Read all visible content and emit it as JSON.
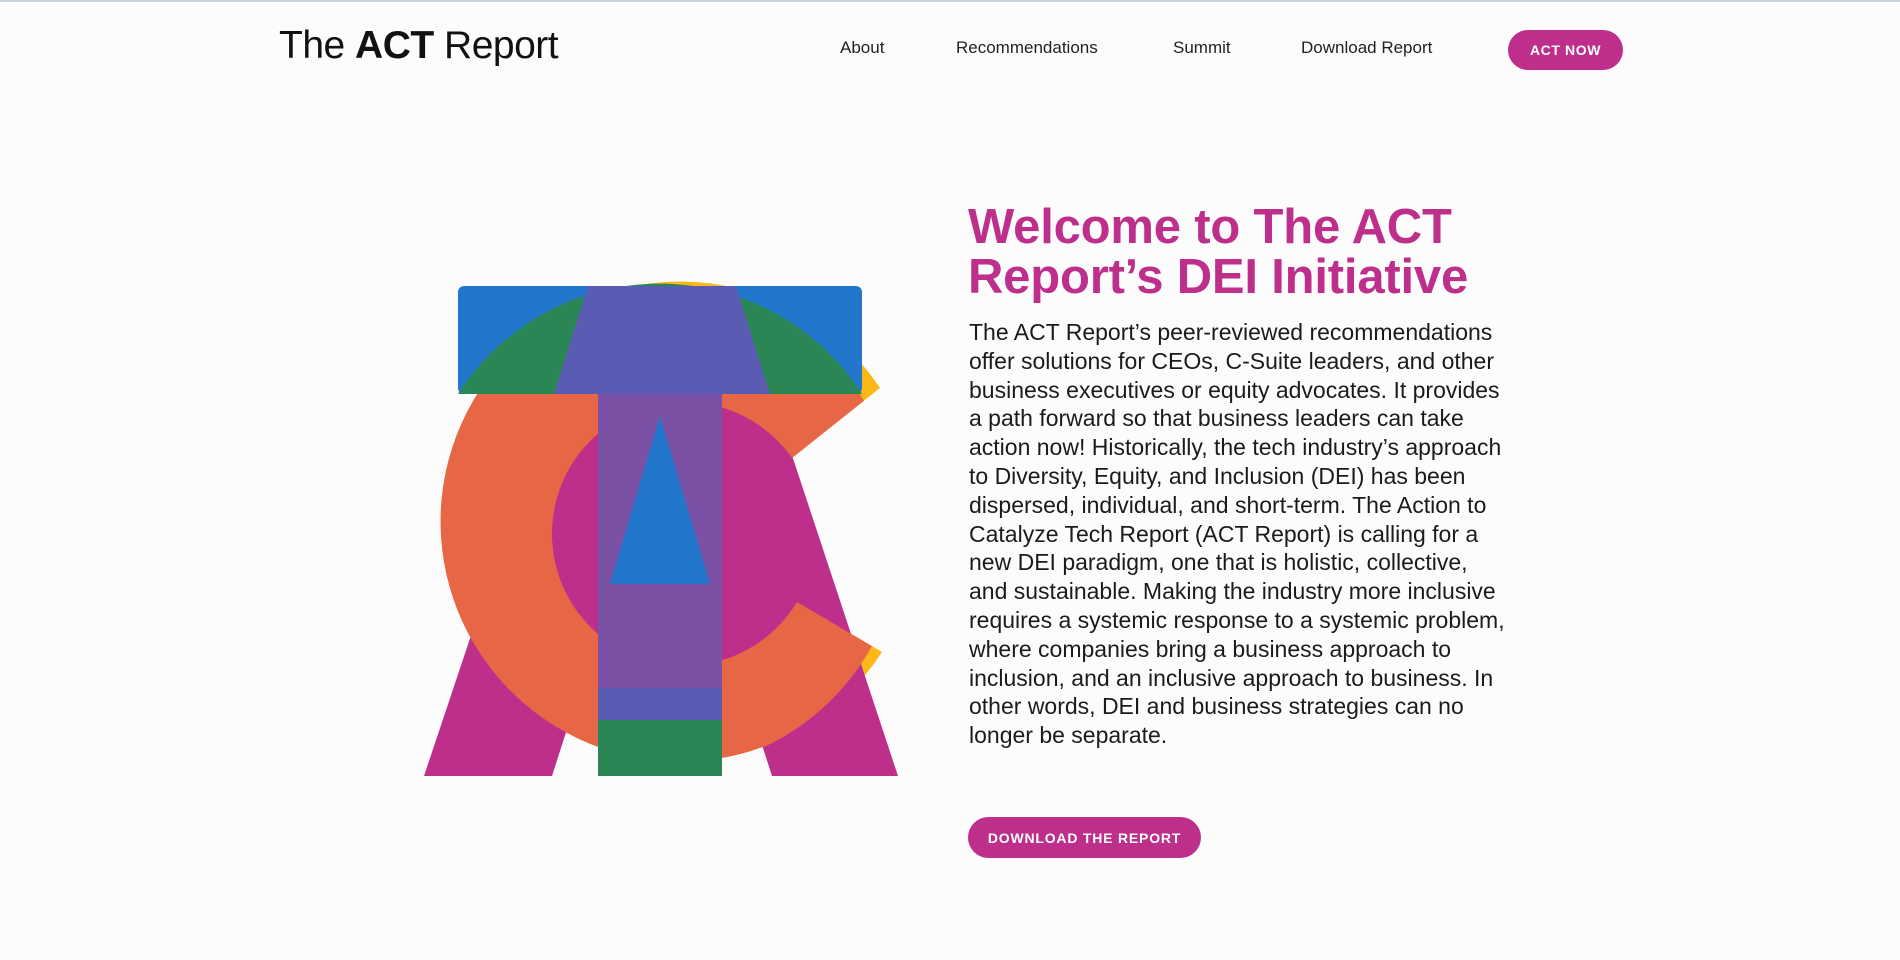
{
  "header": {
    "logo": {
      "part1": "The ",
      "part2": "ACT",
      "part3": " Report"
    },
    "nav": [
      {
        "label": "About"
      },
      {
        "label": "Recommendations"
      },
      {
        "label": "Summit"
      },
      {
        "label": "Download Report"
      }
    ],
    "cta_label": "ACT NOW"
  },
  "hero": {
    "title": "Welcome to The ACT Report’s DEI Initiative",
    "body": "The ACT Report’s peer-reviewed recommendations offer solutions for CEOs, C-Suite leaders, and other business executives or equity advocates. It provides a path forward so that business leaders can take action now! Historically, the tech industry’s approach to Diversity, Equity, and Inclusion (DEI) has been dispersed, individual, and short-term. The Action to Catalyze Tech Report (ACT Report) is calling for a new DEI paradigm, one that is holistic, collective, and sustainable. Making the industry more inclusive requires a systemic response to a systemic problem, where companies bring a business approach to inclusion, and an inclusive approach to business. In other words, DEI and business strategies can no longer be separate.",
    "button_label": "DOWNLOAD THE REPORT"
  },
  "colors": {
    "brand": "#bd2f8b",
    "blue": "#2277cc",
    "green": "#2a8755",
    "yellow": "#fbb817",
    "orange": "#e76646",
    "purple": "#7b51a6"
  },
  "illustration": {
    "icon": "act-letters-logo-art"
  }
}
